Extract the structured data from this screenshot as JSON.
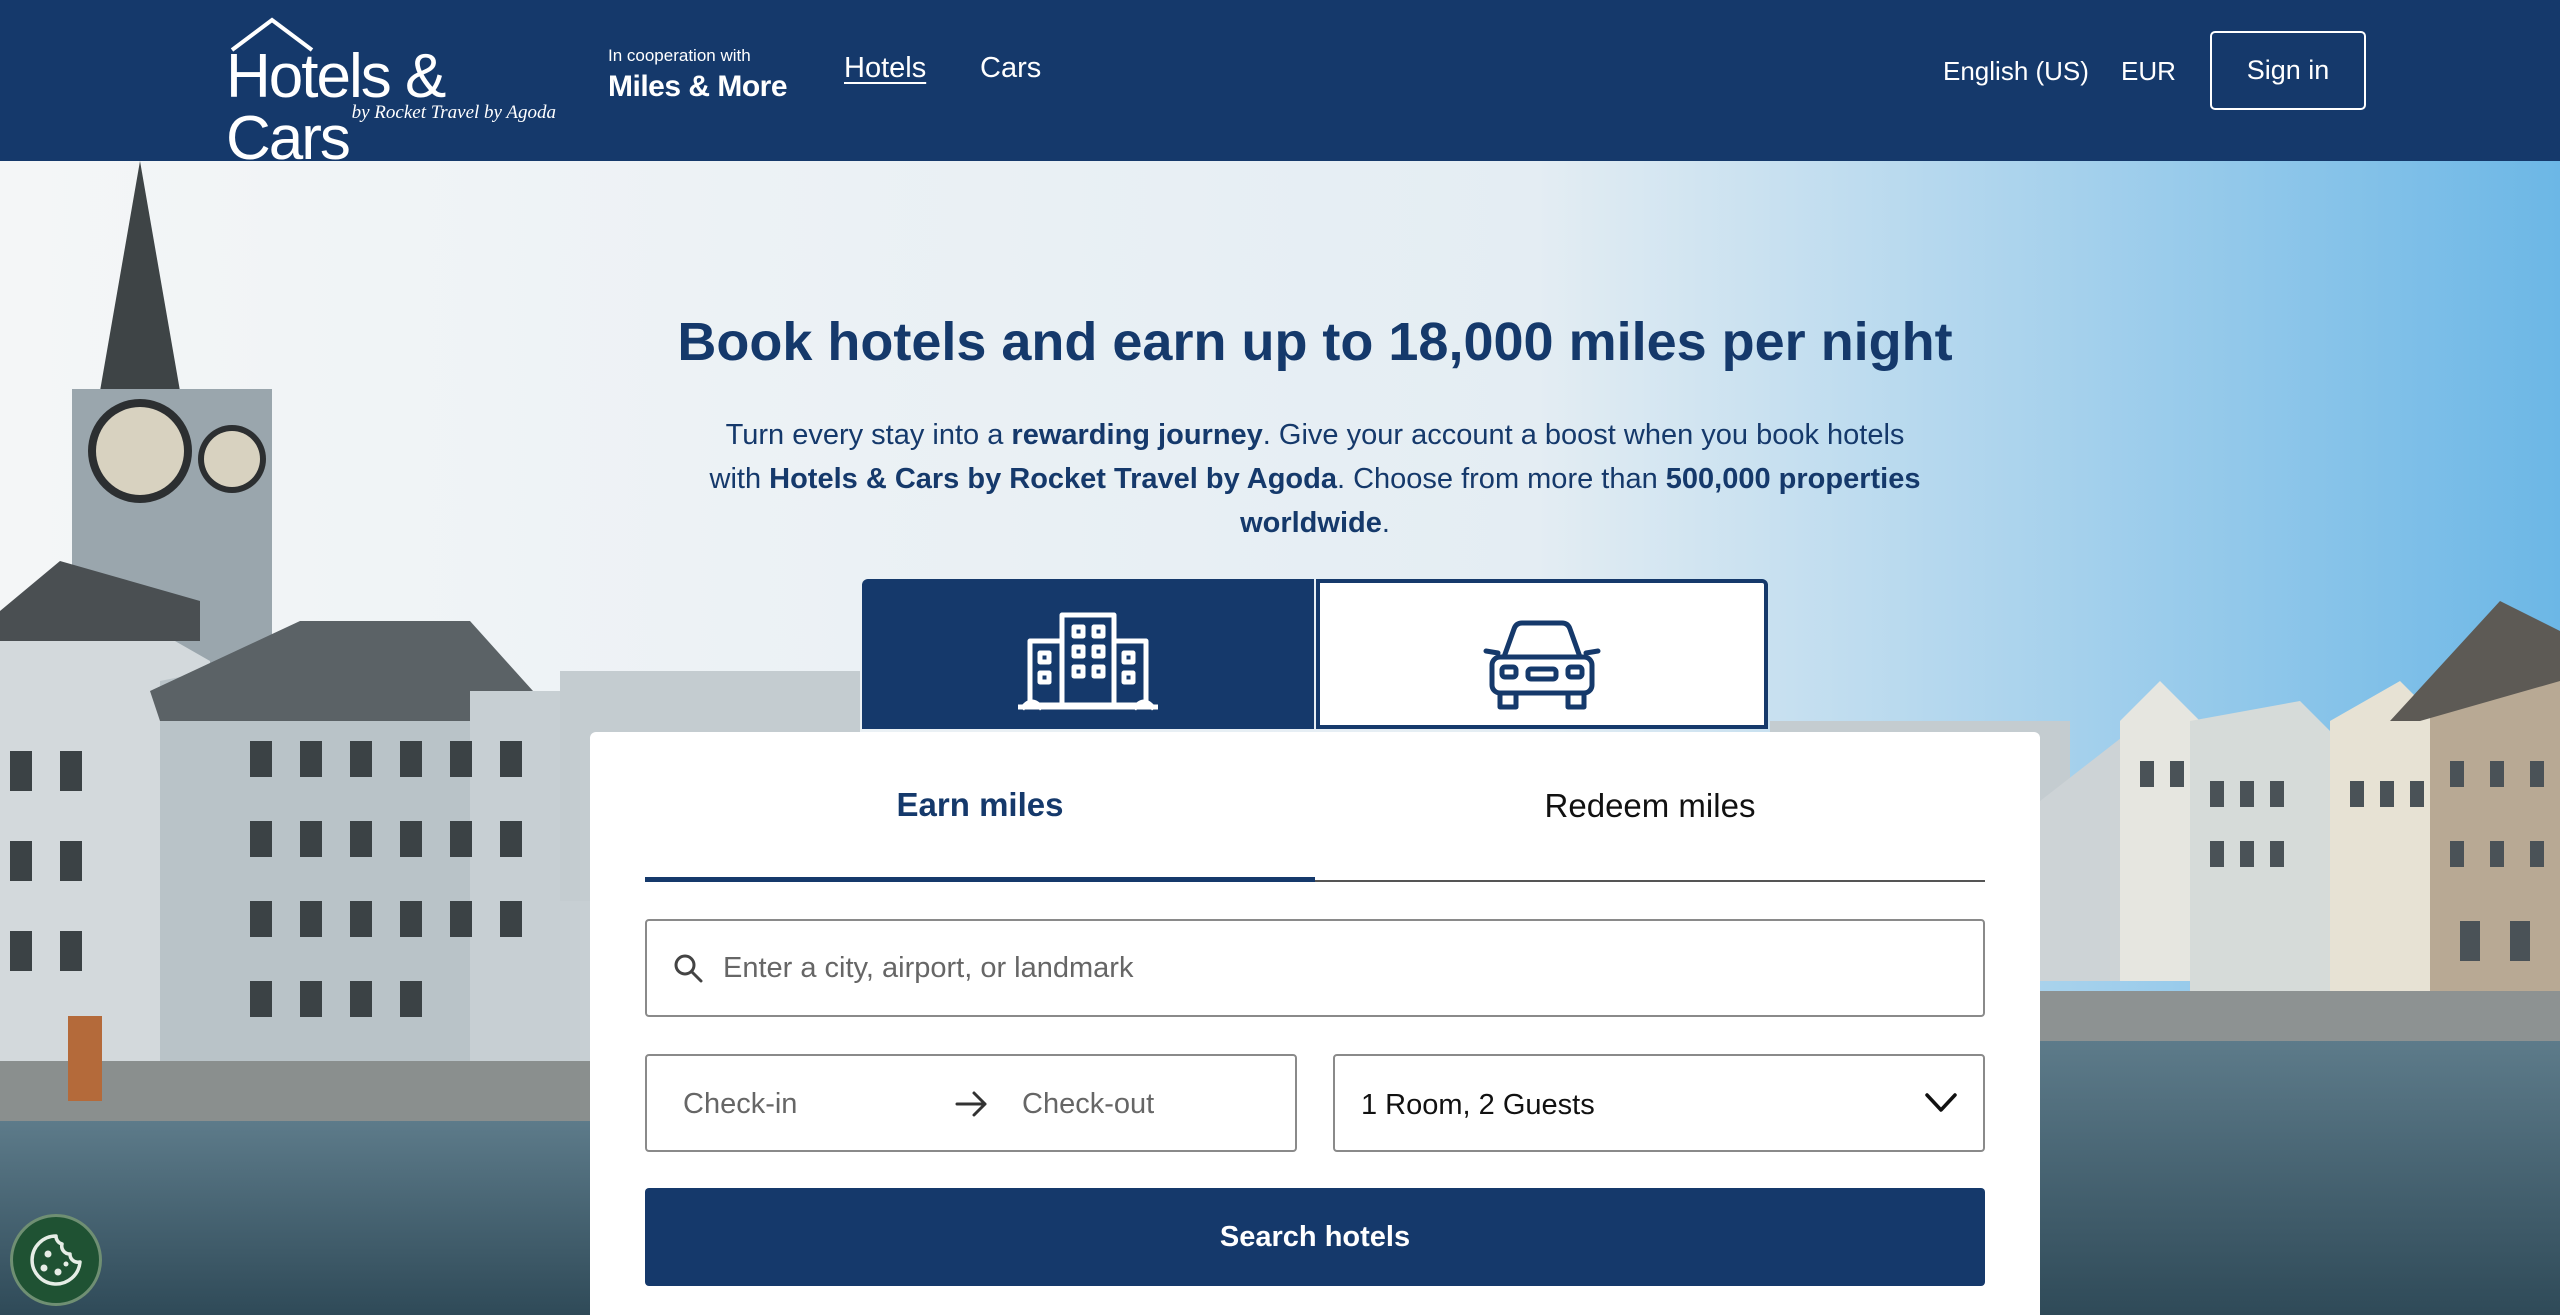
{
  "header": {
    "logo_main": "Hotels & Cars",
    "logo_sub": "by Rocket Travel by Agoda",
    "partner_small": "In cooperation with",
    "partner_name": "Miles & More",
    "nav": [
      {
        "label": "Hotels",
        "active": true
      },
      {
        "label": "Cars",
        "active": false
      }
    ],
    "language": "English (US)",
    "currency": "EUR",
    "signin_label": "Sign in"
  },
  "hero": {
    "title": "Book hotels and earn up to 18,000 miles per night",
    "text_1": "Turn every stay into a ",
    "text_b1": "rewarding journey",
    "text_2": ". Give your account a boost when you book hotels with ",
    "text_b2": "Hotels & Cars by Rocket Travel by Agoda",
    "text_3": ". Choose from more than ",
    "text_b3": "500,000 properties worldwide",
    "text_4": "."
  },
  "product_tabs": [
    {
      "icon": "hotel-building-icon",
      "selected": true
    },
    {
      "icon": "car-icon",
      "selected": false
    }
  ],
  "search": {
    "mode_tabs": [
      {
        "label": "Earn miles",
        "selected": true
      },
      {
        "label": "Redeem miles",
        "selected": false
      }
    ],
    "destination_placeholder": "Enter a city, airport, or landmark",
    "checkin_placeholder": "Check-in",
    "checkout_placeholder": "Check-out",
    "guests_value": "1 Room, 2 Guests",
    "button_label": "Search hotels"
  },
  "colors": {
    "brand_navy": "#15396b",
    "cookie_green": "#1f5233"
  }
}
